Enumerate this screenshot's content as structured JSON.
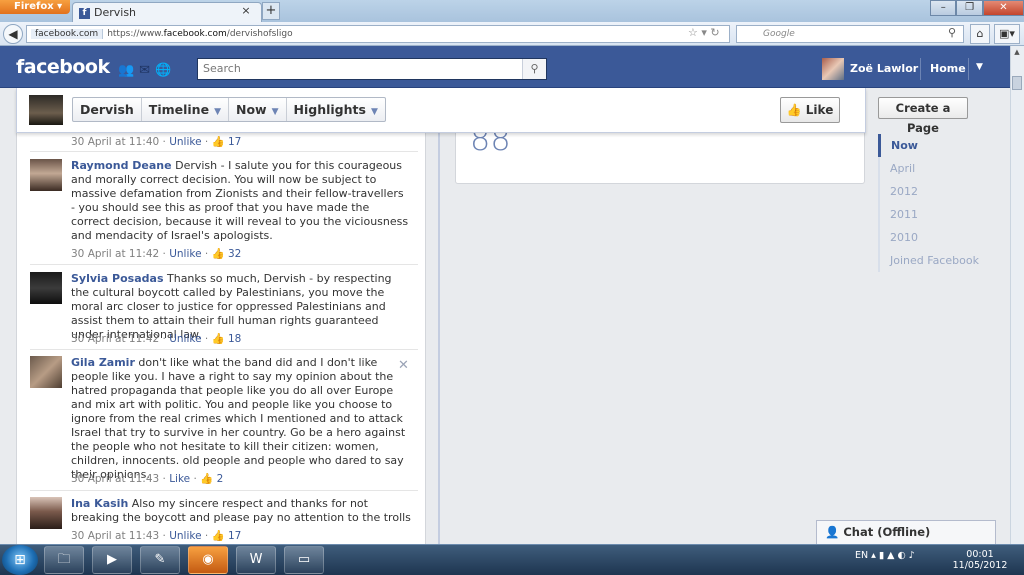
{
  "browser": {
    "app_button": "Firefox",
    "tab_title": "Dervish",
    "url_site": "facebook.com",
    "url_prefix": "https://www.",
    "url_domain": "facebook.com",
    "url_path": "/dervishofsligo",
    "search_placeholder": "Google"
  },
  "facebook": {
    "logo": "facebook",
    "search_placeholder": "Search",
    "user_name": "Zoë Lawlor",
    "home_label": "Home",
    "brand_color": "#3b5998"
  },
  "timeline_header": {
    "tabs": [
      {
        "label": "Dervish",
        "has_caret": false
      },
      {
        "label": "Timeline",
        "has_caret": true
      },
      {
        "label": "Now",
        "has_caret": true
      },
      {
        "label": "Highlights",
        "has_caret": true
      }
    ],
    "like_label": "Like"
  },
  "post": {
    "count": "88"
  },
  "comments": [
    {
      "name": "",
      "text": "",
      "time": "30 April at 11:40",
      "unlike": "Unlike",
      "likes": "17"
    },
    {
      "name": "Raymond Deane",
      "text": "Dervish - I salute you for this courageous and morally correct decision. You will now be subject to massive defamation from Zionists and their fellow-travellers - you should see this as proof that you have made the correct decision, because it will reveal to you the viciousness and mendacity of Israel's apologists.",
      "time": "30 April at 11:42",
      "unlike": "Unlike",
      "likes": "32"
    },
    {
      "name": "Sylvia Posadas",
      "text": "Thanks so much, Dervish - by respecting the cultural boycott called by Palestinians, you move the moral arc closer to justice for oppressed Palestinians and assist them to attain their full human rights guaranteed under international law.",
      "time": "30 April at 11:42",
      "unlike": "Unlike",
      "likes": "18"
    },
    {
      "name": "Gila Zamir",
      "text": "don't like what the band did and I don't like people like you. I have a right to say my opinion about the hatred propaganda that people like you do all over Europe and mix art with politic. You and people like you choose to ignore from the real crimes which I mentioned and to attack Israel that try to survive in her country. Go be a hero against the people who not hesitate to kill their citizen: women, children, innocents. old people and people who dared to say their opinions.",
      "time": "30 April at 11:43",
      "unlike": "Like",
      "likes": "2"
    },
    {
      "name": "Ina Kasih",
      "text": "Also my sincere respect and thanks for not breaking the boycott and please pay no attention to the trolls",
      "time": "30 April at 11:43",
      "unlike": "Unlike",
      "likes": "17"
    }
  ],
  "sidebar": {
    "create_page": "Create a Page",
    "years": [
      "Now",
      "April",
      "2012",
      "2011",
      "2010",
      "Joined Facebook"
    ]
  },
  "chat": {
    "label": "Chat (Offline)"
  },
  "taskbar": {
    "language": "EN",
    "time": "00:01",
    "date": "11/05/2012"
  }
}
